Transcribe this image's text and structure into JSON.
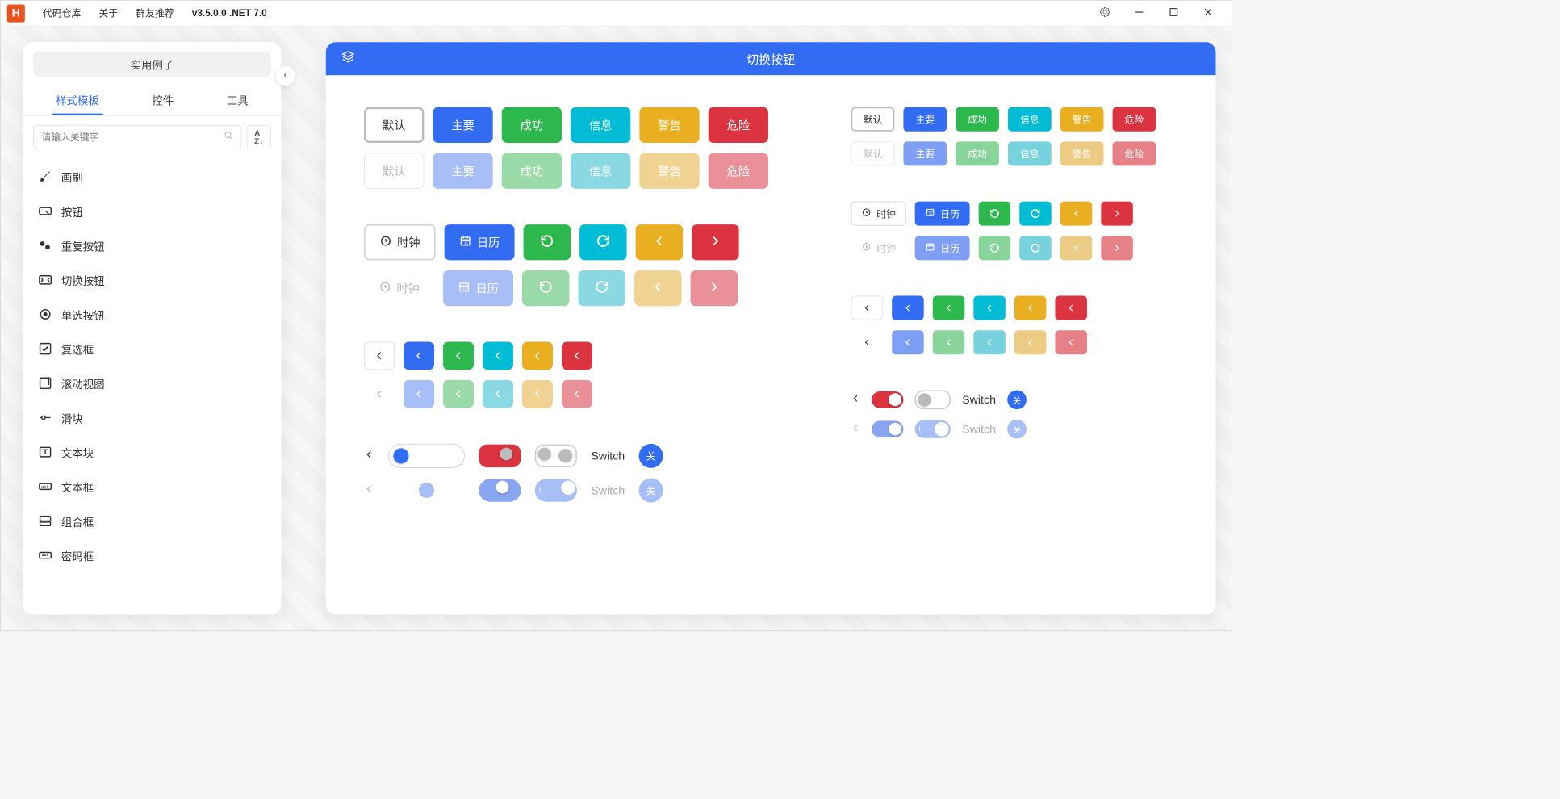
{
  "app": {
    "icon_letter": "H",
    "menu": [
      "代码仓库",
      "关于",
      "群友推荐"
    ],
    "version": "v3.5.0.0 .NET 7.0"
  },
  "sidebar": {
    "header_button": "实用例子",
    "tabs": [
      "样式模板",
      "控件",
      "工具"
    ],
    "active_tab": 0,
    "search": {
      "placeholder": "请输入关键字"
    },
    "items": [
      {
        "icon": "brush",
        "label": "画刷"
      },
      {
        "icon": "button",
        "label": "按钮"
      },
      {
        "icon": "repeat",
        "label": "重复按钮"
      },
      {
        "icon": "toggle",
        "label": "切换按钮"
      },
      {
        "icon": "radio",
        "label": "单选按钮"
      },
      {
        "icon": "checkbox",
        "label": "复选框"
      },
      {
        "icon": "scroll",
        "label": "滚动视图"
      },
      {
        "icon": "slider",
        "label": "滑块"
      },
      {
        "icon": "textblock",
        "label": "文本块"
      },
      {
        "icon": "textbox",
        "label": "文本框"
      },
      {
        "icon": "combobox",
        "label": "组合框"
      },
      {
        "icon": "password",
        "label": "密码框"
      }
    ]
  },
  "card": {
    "title": "切换按钮"
  },
  "labels": {
    "default": "默认",
    "primary": "主要",
    "success": "成功",
    "info": "信息",
    "warning": "警告",
    "danger": "危险",
    "clock": "时钟",
    "calendar": "日历",
    "switch": "Switch",
    "off": "关"
  }
}
